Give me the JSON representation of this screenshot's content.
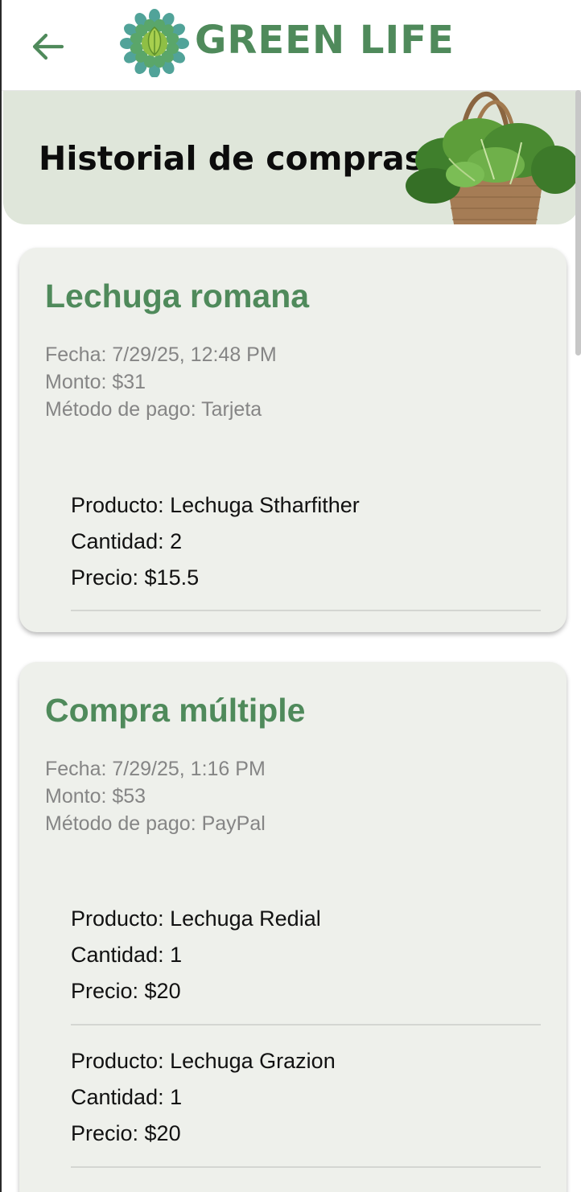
{
  "header": {
    "back_icon": "arrow-left-icon",
    "logo_icon": "green-leaf-mandala-icon",
    "brand": "GREEN LIFE"
  },
  "hero": {
    "title": "Historial de compras",
    "image": "lettuce-basket-illustration"
  },
  "colors": {
    "accent": "#4f8a5b",
    "hero_bg": "#dfe6da",
    "card_bg": "#eef0eb",
    "meta_text": "#858585"
  },
  "purchases": [
    {
      "title": "Lechuga romana",
      "fecha": "Fecha: 7/29/25, 12:48 PM",
      "monto": "Monto: $31",
      "metodo": "Método de pago: Tarjeta",
      "items": [
        {
          "producto": "Producto: Lechuga Stharfither",
          "cantidad": "Cantidad: 2",
          "precio": "Precio: $15.5"
        }
      ]
    },
    {
      "title": "Compra múltiple",
      "fecha": "Fecha: 7/29/25, 1:16 PM",
      "monto": "Monto: $53",
      "metodo": "Método de pago: PayPal",
      "items": [
        {
          "producto": "Producto: Lechuga Redial",
          "cantidad": "Cantidad: 1",
          "precio": "Precio: $20"
        },
        {
          "producto": "Producto: Lechuga Grazion",
          "cantidad": "Cantidad: 1",
          "precio": "Precio: $20"
        }
      ]
    }
  ]
}
